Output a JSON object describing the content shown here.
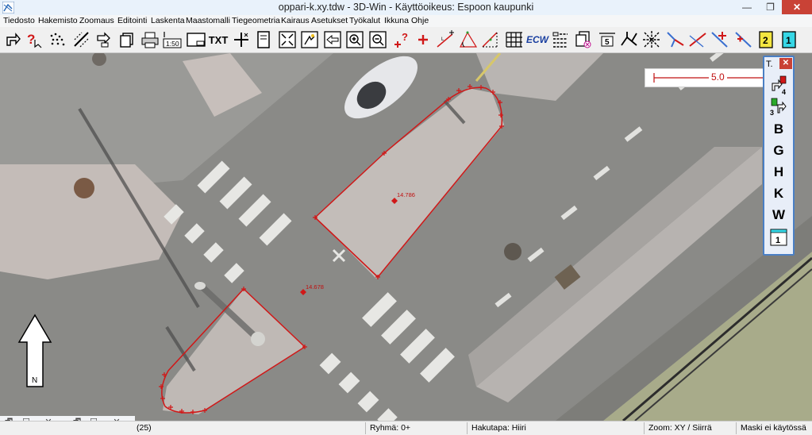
{
  "window": {
    "title": "oppari-k.xy.tdw - 3D-Win - Käyttöoikeus: Espoon kaupunki",
    "min_glyph": "—",
    "max_glyph": "❐",
    "close_glyph": "✕"
  },
  "menu": [
    "Tiedosto",
    "Hakemisto",
    "Zoomaus",
    "Editointi",
    "Laskenta",
    "Maastomalli",
    "Tiegeometria",
    "Kairaus",
    "Asetukset",
    "Työkalut",
    "Ikkuna",
    "Ohje"
  ],
  "toolbar": {
    "icons": [
      "select-arrow-icon",
      "help-query-icon",
      "point-cloud-icon",
      "edit-points-icon",
      "move-arrow-icon",
      "copy-icon",
      "print-icon",
      "scale-150-icon",
      "drawing-sheet-icon",
      "text-tool-icon",
      "cross-cursor-icon",
      "page-icon",
      "zoom-extents-icon",
      "pan-icon",
      "zoom-previous-icon",
      "zoom-in-icon",
      "zoom-out-icon",
      "info-point-icon",
      "add-point-icon",
      "measure-line-icon",
      "angle-icon",
      "slope-icon",
      "grid-icon",
      "ecw-icon",
      "layers-icon",
      "remove-layer-icon",
      "number-5-icon",
      "network-icon",
      "triangulation-icon",
      "polyline-blue-icon",
      "polyline-red-icon",
      "add-node-icon",
      "number-2-icon",
      "number-1-icon"
    ],
    "labels": {
      "scale_150": "1:50",
      "text_tool": "TXT",
      "ecw": "ECW",
      "num5": "5",
      "num2": "2",
      "num1": "1"
    }
  },
  "map": {
    "scale_value": "5.0",
    "points": [
      {
        "label": "14.786"
      },
      {
        "label": "14.678"
      }
    ],
    "north_label": "N"
  },
  "palette": {
    "title": "T.",
    "close_glyph": "✕",
    "items": [
      {
        "icon": "rotate-up-icon",
        "badge": "4"
      },
      {
        "icon": "rotate-down-icon",
        "badge": "3"
      },
      {
        "letter": "B"
      },
      {
        "letter": "G"
      },
      {
        "letter": "H"
      },
      {
        "letter": "K"
      },
      {
        "letter": "W"
      },
      {
        "icon": "layer-one-icon",
        "badge": "1"
      }
    ]
  },
  "statusbar": {
    "cell1": "(25)",
    "group": "Ryhmä: 0+",
    "search_mode": "Hakutapa: Hiiri",
    "zoom_mode": "Zoom: XY  /  Siirrä",
    "mask": "Maski ei käytössä"
  },
  "minimized_windows": [
    {
      "restore": "🗗",
      "maximize": "☐",
      "close": "✕"
    },
    {
      "restore": "🗗",
      "maximize": "☐",
      "close": "✕"
    }
  ],
  "colors": {
    "line_red": "#d01818",
    "title_bg": "#e9f2fb",
    "close_red": "#c94236",
    "palette_border": "#4a7fc4"
  }
}
